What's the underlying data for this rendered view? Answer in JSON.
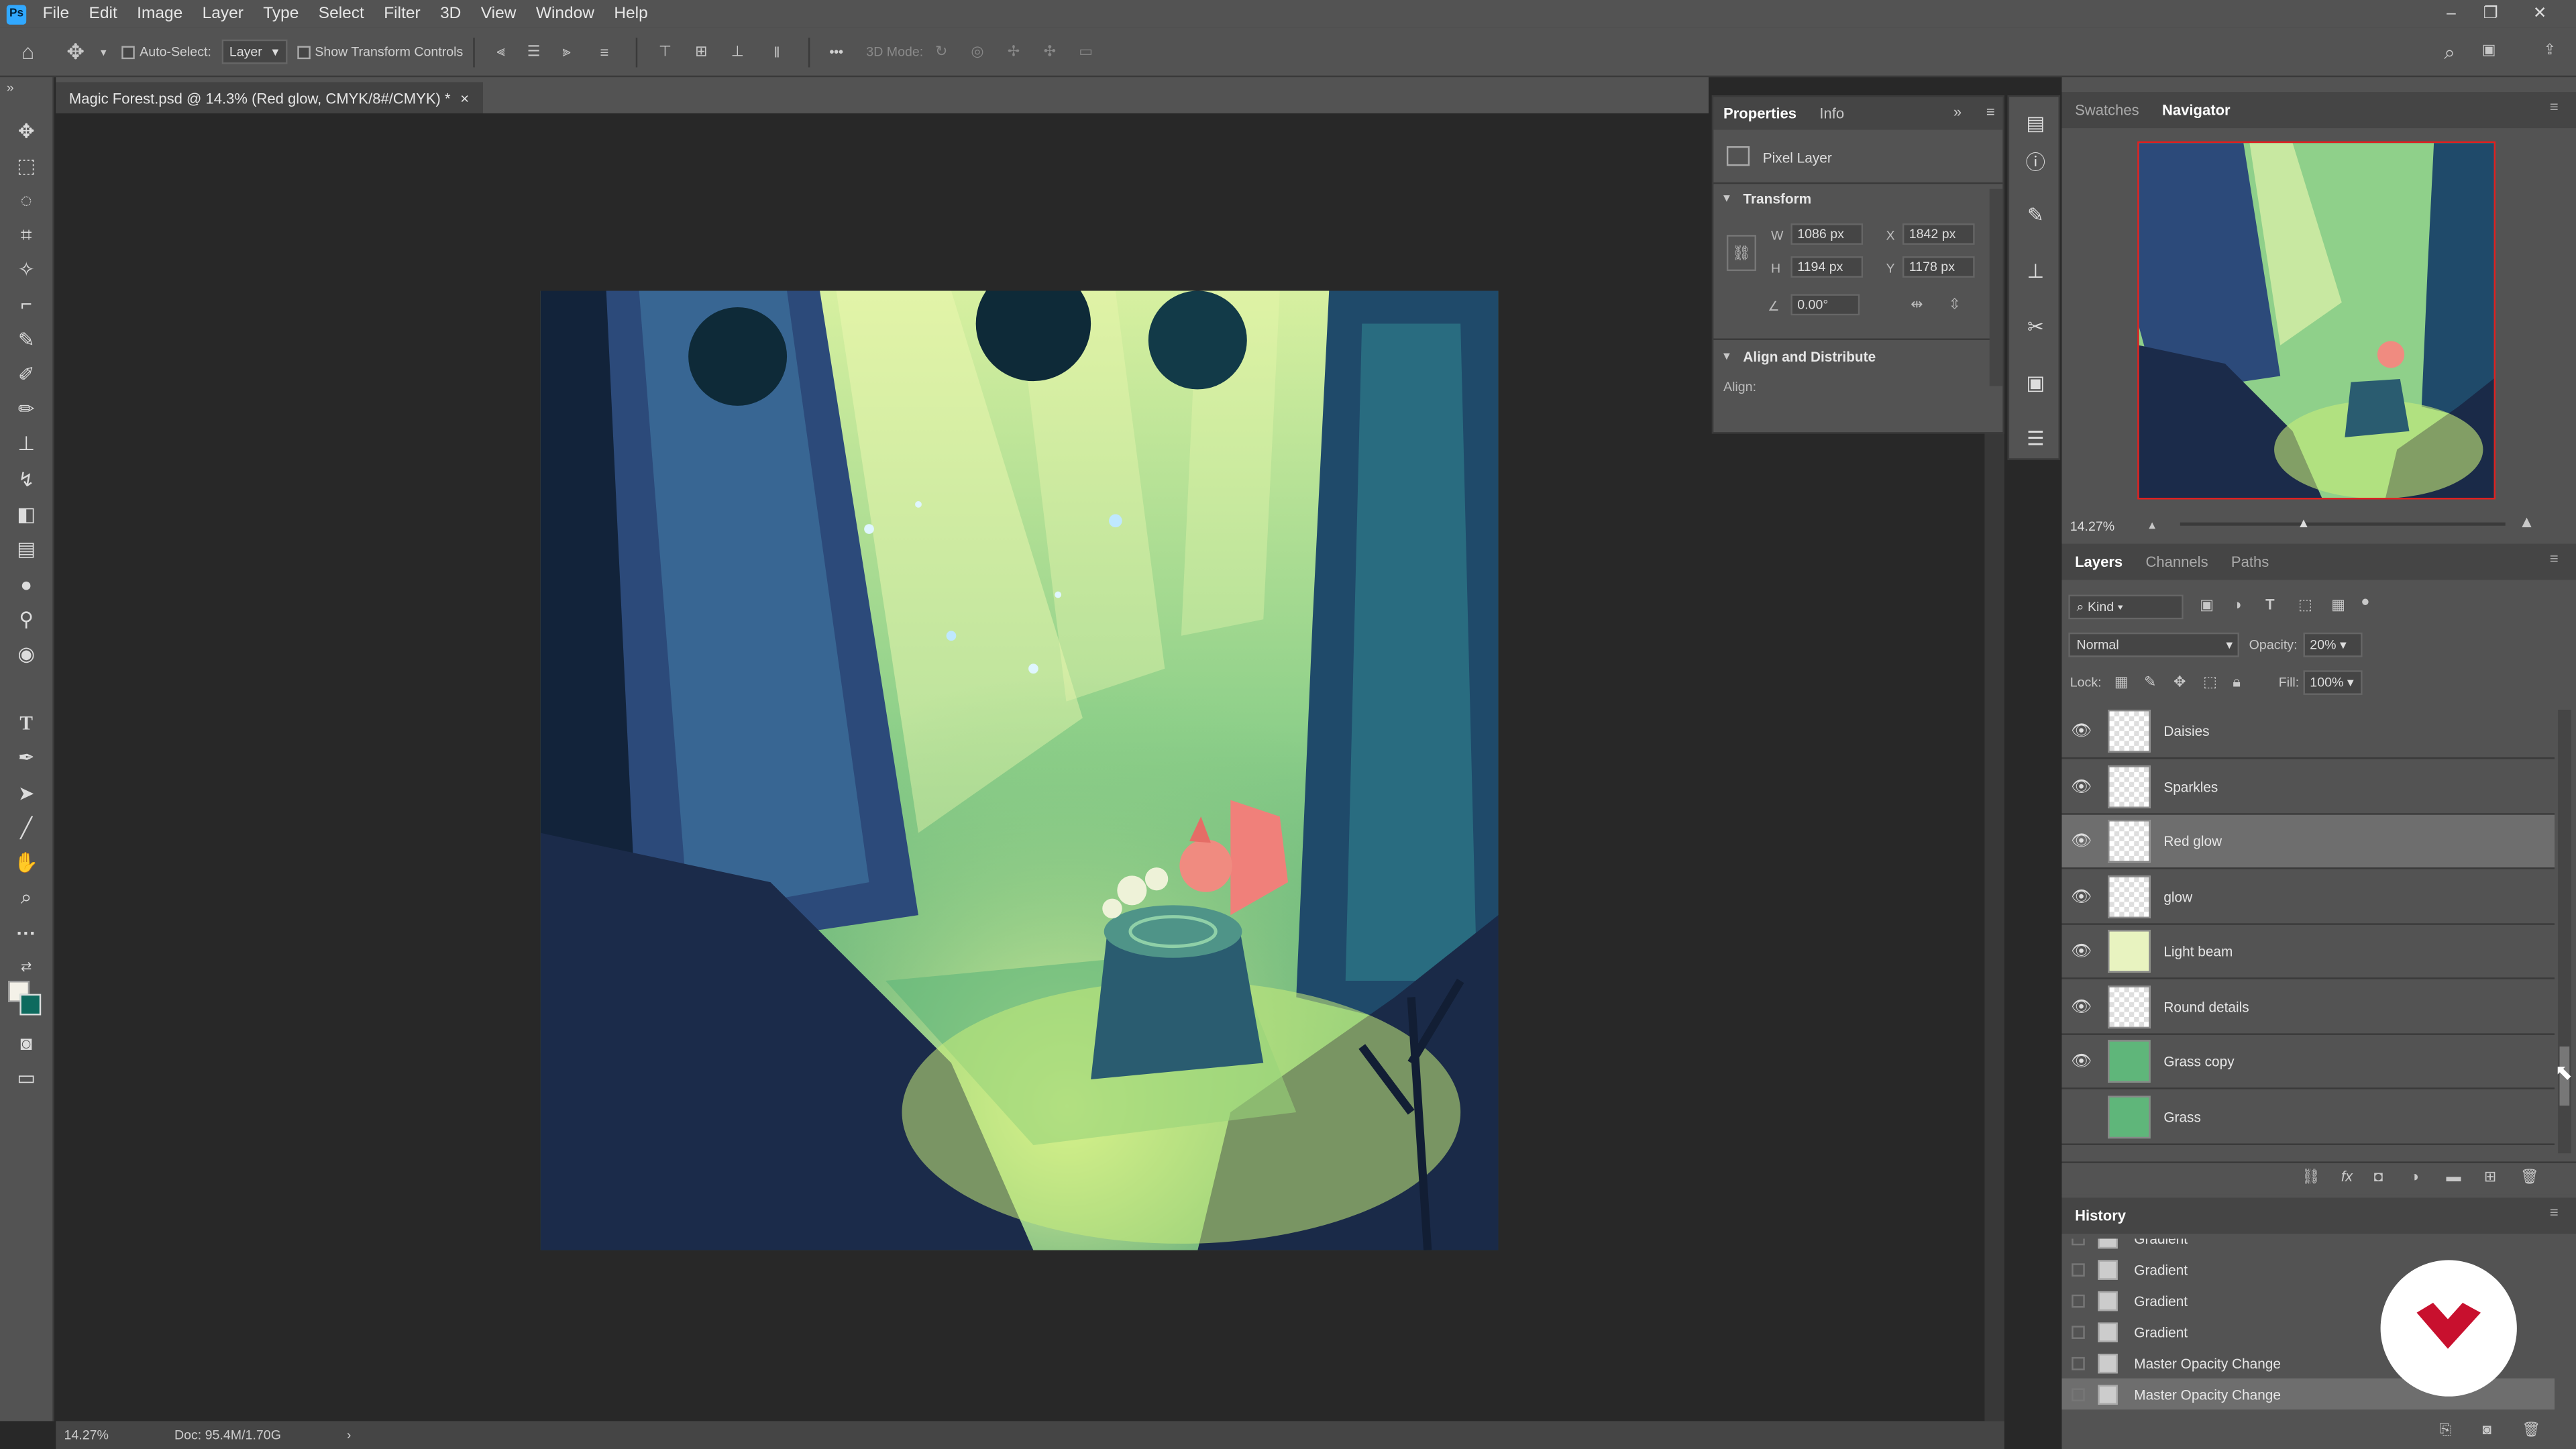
{
  "app": {
    "logo": "Ps"
  },
  "menu": [
    "File",
    "Edit",
    "Image",
    "Layer",
    "Type",
    "Select",
    "Filter",
    "3D",
    "View",
    "Window",
    "Help"
  ],
  "window_controls": {
    "minimize": "–",
    "restore": "❐",
    "close": "✕"
  },
  "options": {
    "auto_select_label": "Auto-Select:",
    "auto_select_target": "Layer",
    "show_transform_label": "Show Transform Controls",
    "three_d_mode_label": "3D Mode:",
    "more": "•••"
  },
  "document": {
    "tab_title": "Magic Forest.psd @ 14.3% (Red glow, CMYK/8#/CMYK) *",
    "tab_close": "×",
    "zoom": "14.27%",
    "doc_size": "Doc: 95.4M/1.70G",
    "status_arrow": "›"
  },
  "properties": {
    "tabs": [
      "Properties",
      "Info"
    ],
    "layer_type": "Pixel Layer",
    "transform_section": "Transform",
    "w_label": "W",
    "w_value": "1086 px",
    "h_label": "H",
    "h_value": "1194 px",
    "x_label": "X",
    "x_value": "1842 px",
    "y_label": "Y",
    "y_value": "1178 px",
    "angle_value": "0.00°",
    "align_section": "Align and Distribute",
    "align_label": "Align:"
  },
  "navigator": {
    "tabs": [
      "Swatches",
      "Navigator"
    ],
    "zoom": "14.27%",
    "zoom_level": 0.38
  },
  "layers_panel": {
    "tabs": [
      "Layers",
      "Channels",
      "Paths"
    ],
    "filter_kind": "Kind",
    "blend_mode": "Normal",
    "opacity_label": "Opacity:",
    "opacity_value": "20%",
    "lock_label": "Lock:",
    "fill_label": "Fill:",
    "fill_value": "100%",
    "layers": [
      {
        "name": "Daisies",
        "visible": true,
        "selected": false
      },
      {
        "name": "Sparkles",
        "visible": true,
        "selected": false
      },
      {
        "name": "Red glow",
        "visible": true,
        "selected": true
      },
      {
        "name": "glow",
        "visible": true,
        "selected": false
      },
      {
        "name": "Light beam",
        "visible": true,
        "selected": false
      },
      {
        "name": "Round details",
        "visible": true,
        "selected": false
      },
      {
        "name": "Grass copy",
        "visible": true,
        "selected": false
      },
      {
        "name": "Grass",
        "visible": false,
        "selected": false
      }
    ]
  },
  "history_panel": {
    "title": "History",
    "items": [
      {
        "name": "Gradient",
        "selected": false
      },
      {
        "name": "Gradient",
        "selected": false
      },
      {
        "name": "Gradient",
        "selected": false
      },
      {
        "name": "Gradient",
        "selected": false
      },
      {
        "name": "Master Opacity Change",
        "selected": false
      },
      {
        "name": "Master Opacity Change",
        "selected": true
      }
    ]
  },
  "colors": {
    "accent": "#31a8ff",
    "ui_panel": "#535353",
    "ui_dark": "#282828",
    "watermark_red": "#c8102e"
  }
}
